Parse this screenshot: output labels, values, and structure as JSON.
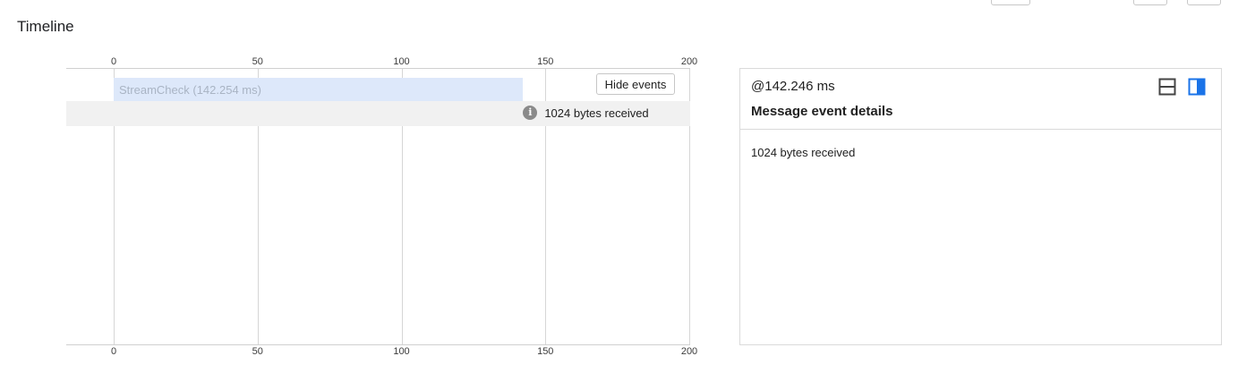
{
  "page": {
    "title": "Timeline"
  },
  "timeline": {
    "axis_ticks": [
      "0",
      "50",
      "100",
      "150",
      "200"
    ],
    "axis_range": [
      0,
      200
    ],
    "span": {
      "label": "StreamCheck (142.254 ms)",
      "start_ms": 0,
      "end_ms": 142.254
    },
    "event": {
      "label": "1024 bytes received",
      "time_ms": 142.246,
      "icon": "info-icon"
    },
    "hide_events_label": "Hide events"
  },
  "details": {
    "timestamp": "@142.246 ms",
    "title": "Message event details",
    "body": "1024 bytes received",
    "layout_icons": [
      "split-horizontal-icon",
      "split-vertical-icon"
    ],
    "active_color": "#1a73e8"
  }
}
